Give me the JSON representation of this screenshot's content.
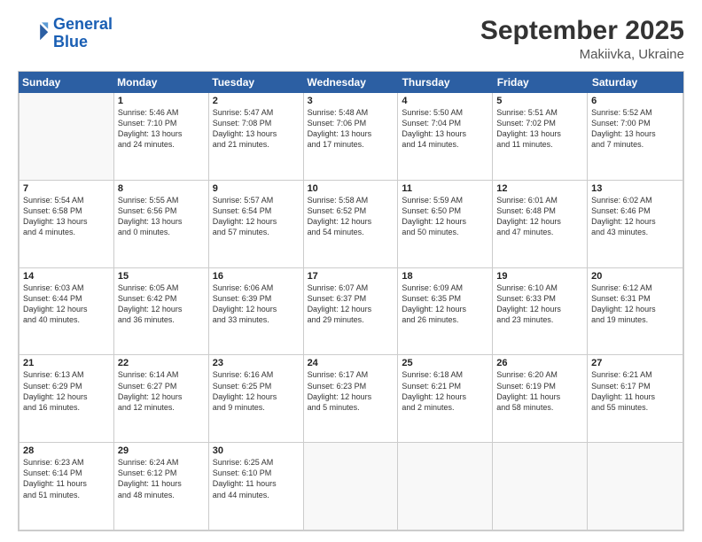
{
  "logo": {
    "line1": "General",
    "line2": "Blue"
  },
  "title": "September 2025",
  "location": "Makiivka, Ukraine",
  "days_header": [
    "Sunday",
    "Monday",
    "Tuesday",
    "Wednesday",
    "Thursday",
    "Friday",
    "Saturday"
  ],
  "weeks": [
    [
      {
        "day": "",
        "lines": []
      },
      {
        "day": "1",
        "lines": [
          "Sunrise: 5:46 AM",
          "Sunset: 7:10 PM",
          "Daylight: 13 hours",
          "and 24 minutes."
        ]
      },
      {
        "day": "2",
        "lines": [
          "Sunrise: 5:47 AM",
          "Sunset: 7:08 PM",
          "Daylight: 13 hours",
          "and 21 minutes."
        ]
      },
      {
        "day": "3",
        "lines": [
          "Sunrise: 5:48 AM",
          "Sunset: 7:06 PM",
          "Daylight: 13 hours",
          "and 17 minutes."
        ]
      },
      {
        "day": "4",
        "lines": [
          "Sunrise: 5:50 AM",
          "Sunset: 7:04 PM",
          "Daylight: 13 hours",
          "and 14 minutes."
        ]
      },
      {
        "day": "5",
        "lines": [
          "Sunrise: 5:51 AM",
          "Sunset: 7:02 PM",
          "Daylight: 13 hours",
          "and 11 minutes."
        ]
      },
      {
        "day": "6",
        "lines": [
          "Sunrise: 5:52 AM",
          "Sunset: 7:00 PM",
          "Daylight: 13 hours",
          "and 7 minutes."
        ]
      }
    ],
    [
      {
        "day": "7",
        "lines": [
          "Sunrise: 5:54 AM",
          "Sunset: 6:58 PM",
          "Daylight: 13 hours",
          "and 4 minutes."
        ]
      },
      {
        "day": "8",
        "lines": [
          "Sunrise: 5:55 AM",
          "Sunset: 6:56 PM",
          "Daylight: 13 hours",
          "and 0 minutes."
        ]
      },
      {
        "day": "9",
        "lines": [
          "Sunrise: 5:57 AM",
          "Sunset: 6:54 PM",
          "Daylight: 12 hours",
          "and 57 minutes."
        ]
      },
      {
        "day": "10",
        "lines": [
          "Sunrise: 5:58 AM",
          "Sunset: 6:52 PM",
          "Daylight: 12 hours",
          "and 54 minutes."
        ]
      },
      {
        "day": "11",
        "lines": [
          "Sunrise: 5:59 AM",
          "Sunset: 6:50 PM",
          "Daylight: 12 hours",
          "and 50 minutes."
        ]
      },
      {
        "day": "12",
        "lines": [
          "Sunrise: 6:01 AM",
          "Sunset: 6:48 PM",
          "Daylight: 12 hours",
          "and 47 minutes."
        ]
      },
      {
        "day": "13",
        "lines": [
          "Sunrise: 6:02 AM",
          "Sunset: 6:46 PM",
          "Daylight: 12 hours",
          "and 43 minutes."
        ]
      }
    ],
    [
      {
        "day": "14",
        "lines": [
          "Sunrise: 6:03 AM",
          "Sunset: 6:44 PM",
          "Daylight: 12 hours",
          "and 40 minutes."
        ]
      },
      {
        "day": "15",
        "lines": [
          "Sunrise: 6:05 AM",
          "Sunset: 6:42 PM",
          "Daylight: 12 hours",
          "and 36 minutes."
        ]
      },
      {
        "day": "16",
        "lines": [
          "Sunrise: 6:06 AM",
          "Sunset: 6:39 PM",
          "Daylight: 12 hours",
          "and 33 minutes."
        ]
      },
      {
        "day": "17",
        "lines": [
          "Sunrise: 6:07 AM",
          "Sunset: 6:37 PM",
          "Daylight: 12 hours",
          "and 29 minutes."
        ]
      },
      {
        "day": "18",
        "lines": [
          "Sunrise: 6:09 AM",
          "Sunset: 6:35 PM",
          "Daylight: 12 hours",
          "and 26 minutes."
        ]
      },
      {
        "day": "19",
        "lines": [
          "Sunrise: 6:10 AM",
          "Sunset: 6:33 PM",
          "Daylight: 12 hours",
          "and 23 minutes."
        ]
      },
      {
        "day": "20",
        "lines": [
          "Sunrise: 6:12 AM",
          "Sunset: 6:31 PM",
          "Daylight: 12 hours",
          "and 19 minutes."
        ]
      }
    ],
    [
      {
        "day": "21",
        "lines": [
          "Sunrise: 6:13 AM",
          "Sunset: 6:29 PM",
          "Daylight: 12 hours",
          "and 16 minutes."
        ]
      },
      {
        "day": "22",
        "lines": [
          "Sunrise: 6:14 AM",
          "Sunset: 6:27 PM",
          "Daylight: 12 hours",
          "and 12 minutes."
        ]
      },
      {
        "day": "23",
        "lines": [
          "Sunrise: 6:16 AM",
          "Sunset: 6:25 PM",
          "Daylight: 12 hours",
          "and 9 minutes."
        ]
      },
      {
        "day": "24",
        "lines": [
          "Sunrise: 6:17 AM",
          "Sunset: 6:23 PM",
          "Daylight: 12 hours",
          "and 5 minutes."
        ]
      },
      {
        "day": "25",
        "lines": [
          "Sunrise: 6:18 AM",
          "Sunset: 6:21 PM",
          "Daylight: 12 hours",
          "and 2 minutes."
        ]
      },
      {
        "day": "26",
        "lines": [
          "Sunrise: 6:20 AM",
          "Sunset: 6:19 PM",
          "Daylight: 11 hours",
          "and 58 minutes."
        ]
      },
      {
        "day": "27",
        "lines": [
          "Sunrise: 6:21 AM",
          "Sunset: 6:17 PM",
          "Daylight: 11 hours",
          "and 55 minutes."
        ]
      }
    ],
    [
      {
        "day": "28",
        "lines": [
          "Sunrise: 6:23 AM",
          "Sunset: 6:14 PM",
          "Daylight: 11 hours",
          "and 51 minutes."
        ]
      },
      {
        "day": "29",
        "lines": [
          "Sunrise: 6:24 AM",
          "Sunset: 6:12 PM",
          "Daylight: 11 hours",
          "and 48 minutes."
        ]
      },
      {
        "day": "30",
        "lines": [
          "Sunrise: 6:25 AM",
          "Sunset: 6:10 PM",
          "Daylight: 11 hours",
          "and 44 minutes."
        ]
      },
      {
        "day": "",
        "lines": []
      },
      {
        "day": "",
        "lines": []
      },
      {
        "day": "",
        "lines": []
      },
      {
        "day": "",
        "lines": []
      }
    ]
  ]
}
